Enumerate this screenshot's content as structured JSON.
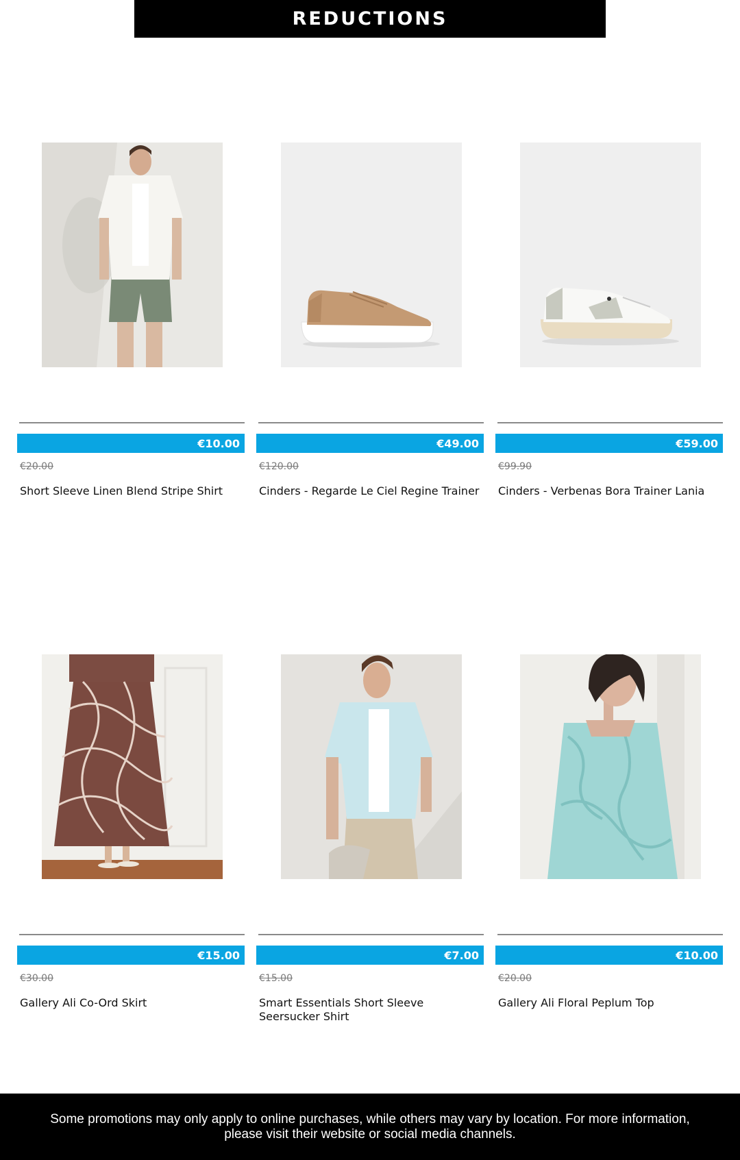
{
  "header": {
    "title": "REDUCTIONS"
  },
  "products": [
    {
      "name": "Short Sleeve Linen Blend Stripe Shirt",
      "price_now": "€10.00",
      "price_was": "€20.00"
    },
    {
      "name": "Cinders - Regarde Le Ciel Regine Trainer",
      "price_now": "€49.00",
      "price_was": "€120.00"
    },
    {
      "name": "Cinders - Verbenas Bora Trainer Lania",
      "price_now": "€59.00",
      "price_was": "€99.90"
    },
    {
      "name": "Gallery Ali Co-Ord Skirt",
      "price_now": "€15.00",
      "price_was": "€30.00"
    },
    {
      "name": "Smart Essentials Short Sleeve Seersucker Shirt",
      "price_now": "€7.00",
      "price_was": "€15.00"
    },
    {
      "name": "Gallery Ali Floral Peplum Top",
      "price_now": "€10.00",
      "price_was": "€20.00"
    }
  ],
  "footer": {
    "text": "Some promotions may only apply to online purchases, while others may vary by location. For more information, please visit their website or social media channels."
  },
  "colors": {
    "price_bar": "#0aa5e2",
    "banner": "#000000",
    "divider": "#8a8a8a"
  }
}
